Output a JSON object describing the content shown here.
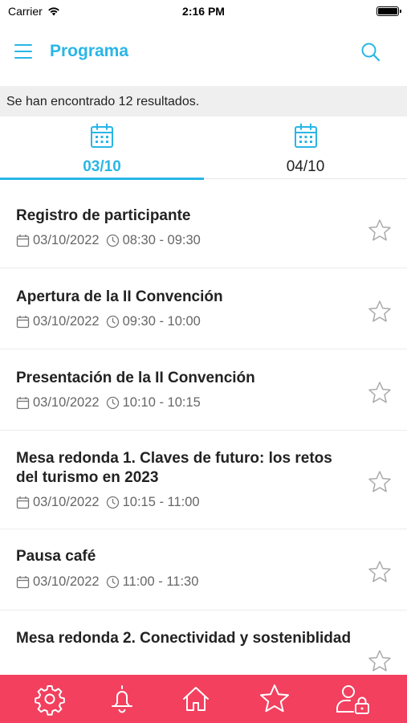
{
  "status_bar": {
    "carrier": "Carrier",
    "time": "2:16 PM"
  },
  "header": {
    "title": "Programa"
  },
  "results": {
    "text": "Se han encontrado 12 resultados."
  },
  "tabs": [
    {
      "label": "03/10",
      "active": true
    },
    {
      "label": "04/10",
      "active": false
    }
  ],
  "items": [
    {
      "title": "Registro de participante",
      "date": "03/10/2022",
      "time": "08:30 - 09:30"
    },
    {
      "title": "Apertura de la II Convención",
      "date": "03/10/2022",
      "time": "09:30 - 10:00"
    },
    {
      "title": "Presentación de la II Convención",
      "date": "03/10/2022",
      "time": "10:10 - 10:15"
    },
    {
      "title": "Mesa redonda 1. Claves de futuro: los retos del turismo en 2023",
      "date": "03/10/2022",
      "time": "10:15 - 11:00"
    },
    {
      "title": "Pausa café",
      "date": "03/10/2022",
      "time": "11:00 - 11:30"
    },
    {
      "title": "Mesa redonda 2. Conectividad y sosteniblidad",
      "date": "",
      "time": ""
    }
  ],
  "colors": {
    "accent": "#29b6e6",
    "nav_background": "#f2405e"
  }
}
